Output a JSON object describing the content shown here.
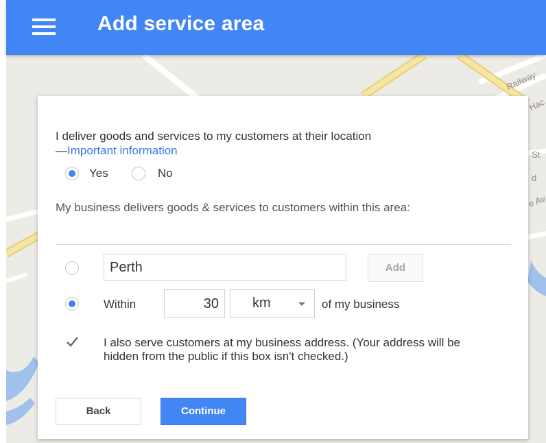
{
  "header": {
    "title": "Add service area",
    "menu_icon": "hamburger-menu-icon"
  },
  "map": {
    "labels": [
      "Railway",
      "Hac",
      "St",
      "d",
      "e Av"
    ],
    "colors": {
      "land": "#ecebe6",
      "major_road": "#f6e6a6",
      "major_road_edge": "#e5cf73",
      "water": "#9fc1ec"
    }
  },
  "question": {
    "text": "I deliver goods and services to my customers at their location",
    "dash": "—",
    "link": "Important information",
    "options": [
      {
        "label": "Yes",
        "checked": true
      },
      {
        "label": "No",
        "checked": false
      }
    ]
  },
  "area": {
    "description": "My business delivers goods & services to customers within this area:",
    "place_input_value": "Perth",
    "add_label": "Add",
    "place_option_checked": false,
    "radius_option_checked": true,
    "within_label": "Within",
    "radius_value": "30",
    "unit_value": "km",
    "suffix_label": "of my business"
  },
  "address_checkbox": {
    "checked": true,
    "text": "I also serve customers at my business address. (Your address will be hidden from the public if this box isn't checked.)"
  },
  "buttons": {
    "back_label": "Back",
    "continue_label": "Continue"
  },
  "colors": {
    "accent": "#4285f4",
    "link": "#3b78e7"
  }
}
